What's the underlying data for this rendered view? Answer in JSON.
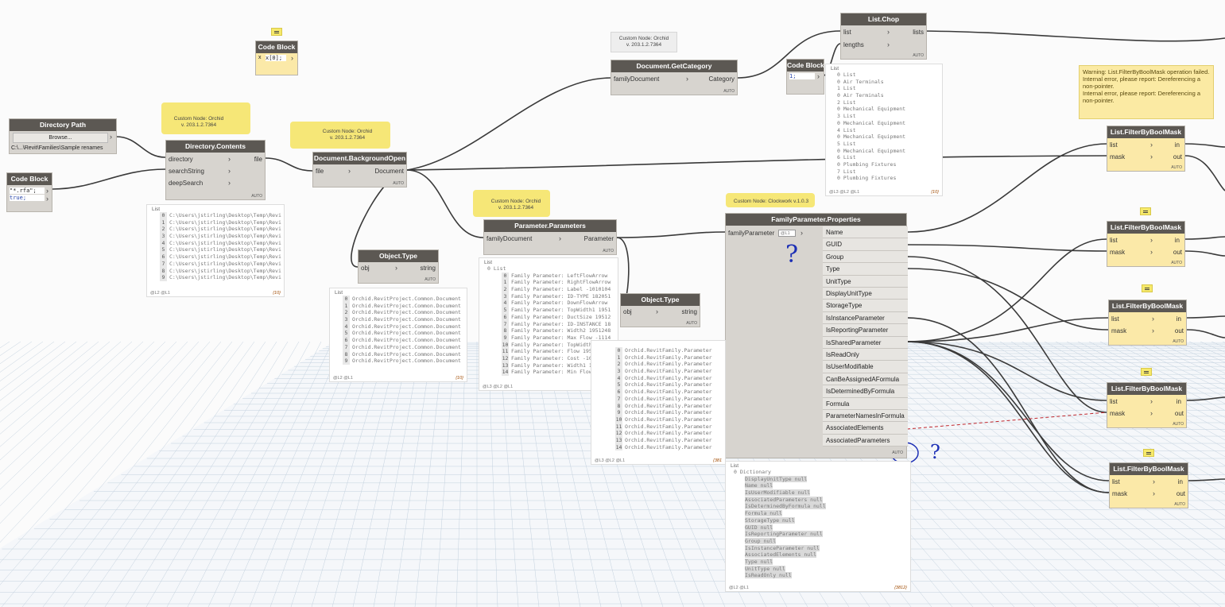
{
  "nodes": {
    "directory_path": {
      "title": "Directory Path",
      "browse": "Browse...",
      "path": "C:\\...\\Revit\\Families\\Sample renames"
    },
    "code_block_rfa": {
      "title": "Code Block",
      "line1": "\"*.rfa\";",
      "line2": "true;"
    },
    "code_block_top": {
      "title": "Code Block",
      "code": "x[0];",
      "input": "x"
    },
    "code_block_chop": {
      "title": "Code Block",
      "code": "1;"
    },
    "directory_contents": {
      "title": "Directory.Contents",
      "in": [
        "directory",
        "searchString",
        "deepSearch"
      ],
      "out": "file",
      "auto": "AUTO"
    },
    "background_open": {
      "title": "Document.BackgroundOpen",
      "in": "file",
      "out": "Document",
      "auto": "AUTO"
    },
    "get_category": {
      "title": "Document.GetCategory",
      "in": "familyDocument",
      "out": "Category",
      "auto": "AUTO"
    },
    "list_chop": {
      "title": "List.Chop",
      "in": [
        "list",
        "lengths"
      ],
      "out": "lists",
      "auto": "AUTO"
    },
    "object_type_1": {
      "title": "Object.Type",
      "in": "obj",
      "out": "string",
      "auto": "AUTO"
    },
    "object_type_2": {
      "title": "Object.Type",
      "in": "obj",
      "out": "string",
      "auto": "AUTO"
    },
    "parameter_parameters": {
      "title": "Parameter.Parameters",
      "in": "familyDocument",
      "out": "Parameter",
      "auto": "AUTO"
    },
    "family_param_props": {
      "title": "FamilyParameter.Properties",
      "in": "familyParameter",
      "lacing": "@L1",
      "auto": "AUTO",
      "out": [
        "Name",
        "GUID",
        "Group",
        "Type",
        "UnitType",
        "DisplayUnitType",
        "StorageType",
        "IsInstanceParameter",
        "IsReportingParameter",
        "IsSharedParameter",
        "IsReadOnly",
        "IsUserModifiable",
        "CanBeAssignedAFormula",
        "IsDeterminedByFormula",
        "Formula",
        "ParameterNamesInFormula",
        "AssociatedElements",
        "AssociatedParameters"
      ]
    },
    "filter_masks": [
      {
        "title": "List.FilterByBoolMask",
        "in": [
          "list",
          "mask"
        ],
        "out": [
          "in",
          "out"
        ],
        "auto": "AUTO"
      },
      {
        "title": "List.FilterByBoolMask",
        "in": [
          "list",
          "mask"
        ],
        "out": [
          "in",
          "out"
        ],
        "auto": "AUTO"
      },
      {
        "title": "List.FilterByBoolMask",
        "in": [
          "list",
          "mask"
        ],
        "out": [
          "in",
          "out"
        ],
        "auto": "AUTO"
      },
      {
        "title": "List.FilterByBoolMask",
        "in": [
          "list",
          "mask"
        ],
        "out": [
          "in",
          "out"
        ],
        "auto": "AUTO"
      },
      {
        "title": "List.FilterByBoolMask",
        "in": [
          "list",
          "mask"
        ],
        "out": [
          "in",
          "out"
        ],
        "auto": "AUTO"
      }
    ]
  },
  "tags": {
    "orchid_a": [
      "Custom Node: Orchid",
      "v. 203.1.2.7364"
    ],
    "orchid_b": [
      "Custom Node: Orchid",
      "v. 203.1.2.7364"
    ],
    "orchid_c": [
      "Custom Node: Orchid",
      "v. 203.1.2.7364"
    ],
    "orchid_d": [
      "Custom Node: Orchid",
      "v. 203.1.2.7364"
    ],
    "clockwork": "Custom Node: Clockwork v.1.0.3"
  },
  "warning": [
    "Warning: List.FilterByBoolMask operation failed.",
    "Internal error, please report: Dereferencing a non-pointer.",
    "Internal error, please report: Dereferencing a non-pointer."
  ],
  "panels": {
    "dir_files": {
      "title": "List",
      "items": [
        "C:\\Users\\jstirling\\Desktop\\Temp\\Revi",
        "C:\\Users\\jstirling\\Desktop\\Temp\\Revi",
        "C:\\Users\\jstirling\\Desktop\\Temp\\Revi",
        "C:\\Users\\jstirling\\Desktop\\Temp\\Revi",
        "C:\\Users\\jstirling\\Desktop\\Temp\\Revi",
        "C:\\Users\\jstirling\\Desktop\\Temp\\Revi",
        "C:\\Users\\jstirling\\Desktop\\Temp\\Revi",
        "C:\\Users\\jstirling\\Desktop\\Temp\\Revi",
        "C:\\Users\\jstirling\\Desktop\\Temp\\Revi",
        "C:\\Users\\jstirling\\Desktop\\Temp\\Revi"
      ],
      "levels": "@L2 @L1",
      "count": "{10}"
    },
    "obj_types": {
      "title": "List",
      "items": [
        "Orchid.RevitProject.Common.Document",
        "Orchid.RevitProject.Common.Document",
        "Orchid.RevitProject.Common.Document",
        "Orchid.RevitProject.Common.Document",
        "Orchid.RevitProject.Common.Document",
        "Orchid.RevitProject.Common.Document",
        "Orchid.RevitProject.Common.Document",
        "Orchid.RevitProject.Common.Document",
        "Orchid.RevitProject.Common.Document",
        "Orchid.RevitProject.Common.Document"
      ],
      "levels": "@L2 @L1",
      "count": "{10}"
    },
    "params": {
      "title": "List",
      "sub": "0 List",
      "items": [
        "Family Parameter: LeftFlowArrow",
        "Family Parameter: RightFlowArrow",
        "Family Parameter: Label -1010104",
        "Family Parameter: ID-TYPE 182051",
        "Family Parameter: DownFlowArrow",
        "Family Parameter: TopWidth1 1951",
        "Family Parameter: DuctSize 19512",
        "Family Parameter: ID-INSTANCE 18",
        "Family Parameter: Width2 1951248",
        "Family Parameter: Max Flow -1114",
        "Family Parameter: TopWidth2 195",
        "Family Parameter: Flow 1951249",
        "Family Parameter: Cost -1001205",
        "Family Parameter: Width1 195123",
        "Family Parameter: Min Flow -111"
      ],
      "levels": "@L3 @L2 @L1",
      "count": "{3812}"
    },
    "family_types": {
      "items": [
        "Orchid.RevitFamily.Parameter",
        "Orchid.RevitFamily.Parameter",
        "Orchid.RevitFamily.Parameter",
        "Orchid.RevitFamily.Parameter",
        "Orchid.RevitFamily.Parameter",
        "Orchid.RevitFamily.Parameter",
        "Orchid.RevitFamily.Parameter",
        "Orchid.RevitFamily.Parameter",
        "Orchid.RevitFamily.Parameter",
        "Orchid.RevitFamily.Parameter",
        "Orchid.RevitFamily.Parameter",
        "Orchid.RevitFamily.Parameter",
        "Orchid.RevitFamily.Parameter",
        "Orchid.RevitFamily.Parameter",
        "Orchid.RevitFamily.Parameter"
      ],
      "levels": "@L3 @L2 @L1",
      "count": "{381"
    },
    "categories": {
      "title": "List",
      "items": [
        "0 List",
        "0  Air Terminals",
        "1 List",
        "0  Air Terminals",
        "2 List",
        "0  Mechanical Equipment",
        "3 List",
        "0  Mechanical Equipment",
        "4 List",
        "0  Mechanical Equipment",
        "5 List",
        "0  Mechanical Equipment",
        "6 List",
        "0  Plumbing Fixtures",
        "7 List",
        "0  Plumbing Fixtures"
      ],
      "levels": "@L3 @L2 @L1",
      "count": "{10}"
    },
    "dictionary": {
      "title": "List",
      "sub": "0  Dictionary",
      "items": [
        "DisplayUnitType  null",
        "Name  null",
        "IsUserModifiable  null",
        "AssociatedParameters  null",
        "IsDeterminedByFormula  null",
        "Formula  null",
        "StorageType  null",
        "GUID  null",
        "IsReportingParameter  null",
        "Group  null",
        "IsInstanceParameter  null",
        "AssociatedElements  null",
        "Type  null",
        "UnitType  null",
        "IsReadOnly  null"
      ],
      "levels": "@L2 @L1",
      "count": "{3812}"
    }
  },
  "annotations": {
    "question_mark": "?"
  },
  "colors": {
    "header": "#5c5853",
    "node_body": "#d7d4cf",
    "warning_bg": "#fbeaa3",
    "highlight": "#f5e56b",
    "wire": "#3a3a3a",
    "annotation": "#1c2fb5"
  }
}
